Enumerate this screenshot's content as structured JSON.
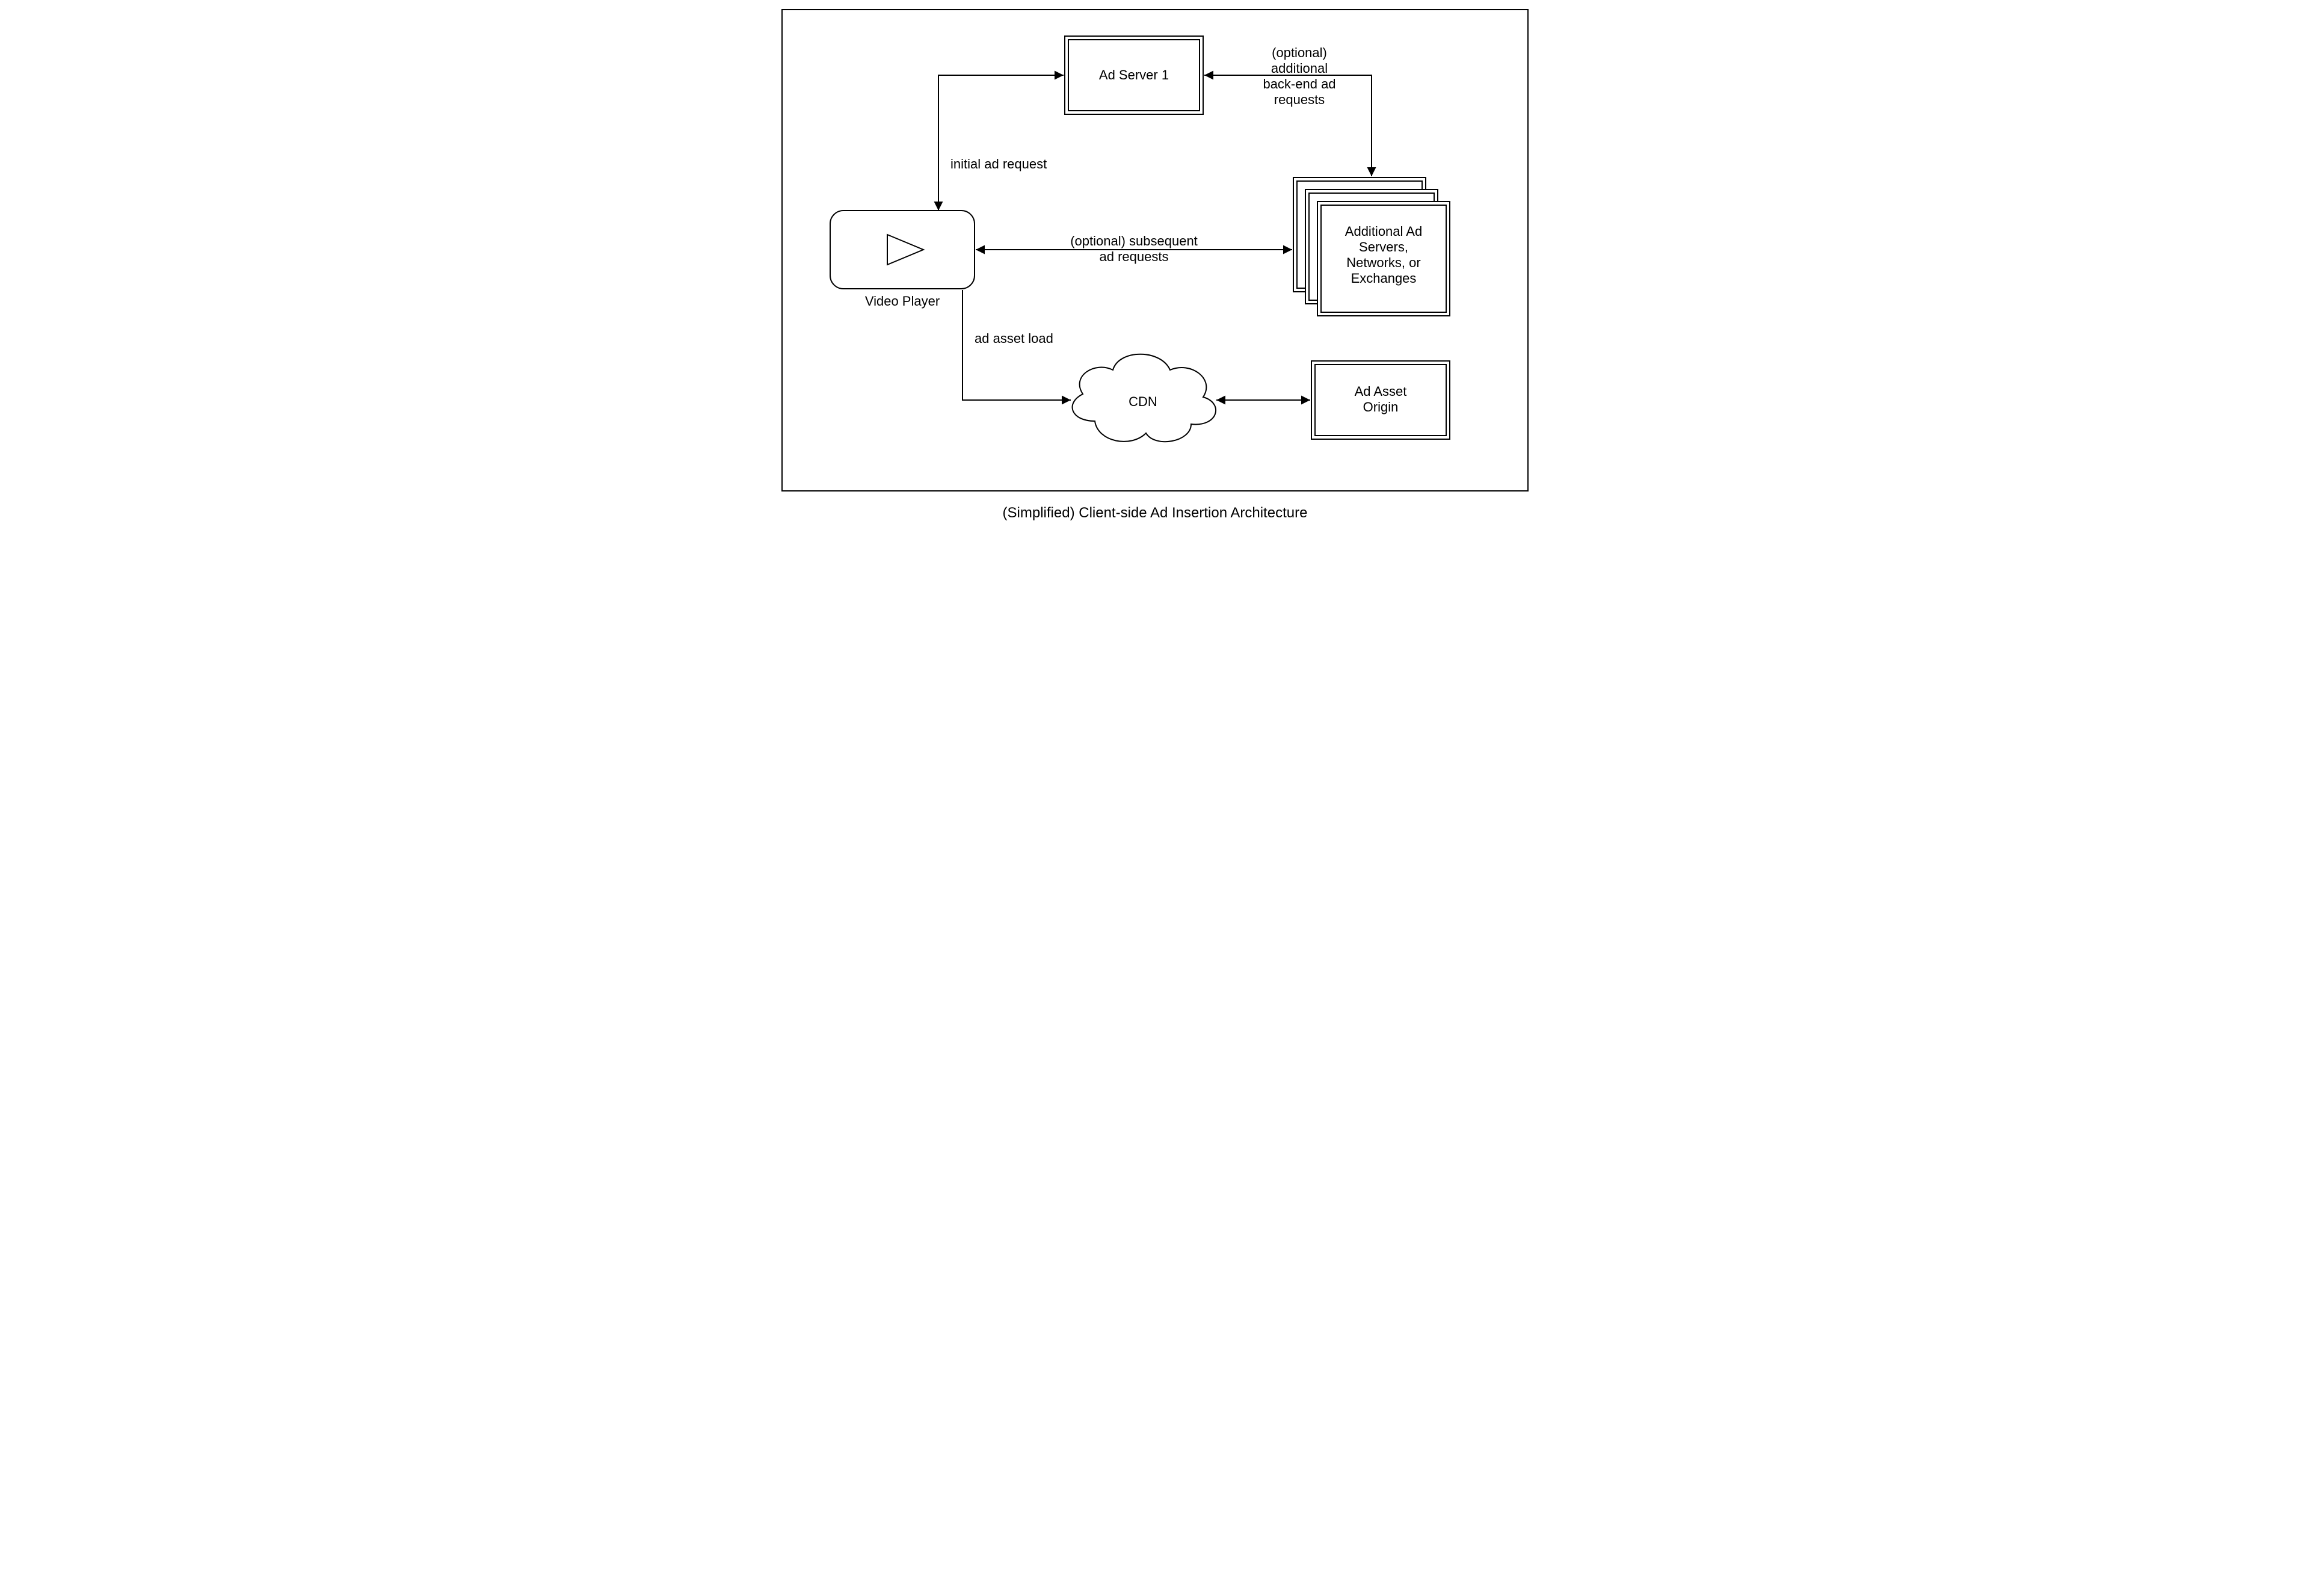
{
  "caption": "(Simplified) Client-side Ad Insertion Architecture",
  "nodes": {
    "video_player": "Video Player",
    "ad_server_1": "Ad Server 1",
    "additional_servers_l1": "Additional Ad",
    "additional_servers_l2": "Servers,",
    "additional_servers_l3": "Networks, or",
    "additional_servers_l4": "Exchanges",
    "cdn": "CDN",
    "ad_asset_origin_l1": "Ad Asset",
    "ad_asset_origin_l2": "Origin"
  },
  "edges": {
    "initial_ad_request": "initial ad request",
    "optional_backend_l1": "(optional)",
    "optional_backend_l2": "additional",
    "optional_backend_l3": "back-end ad",
    "optional_backend_l4": "requests",
    "optional_subsequent_l1": "(optional) subsequent",
    "optional_subsequent_l2": "ad requests",
    "ad_asset_load": "ad asset load"
  }
}
